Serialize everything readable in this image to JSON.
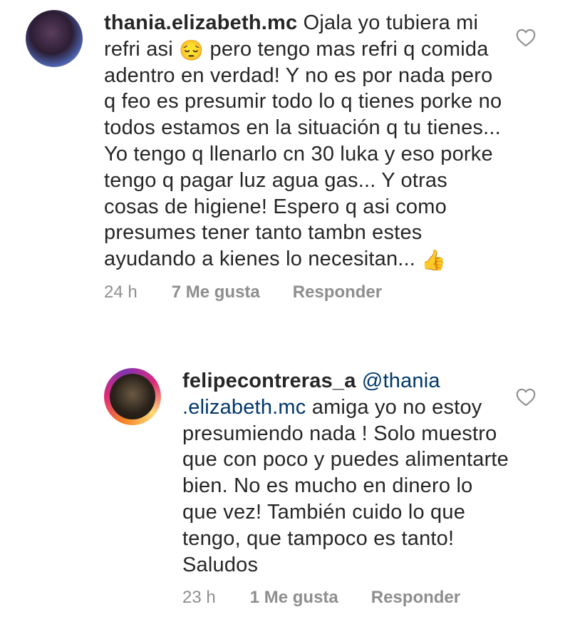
{
  "comments": [
    {
      "username": "thania.elizabeth.mc",
      "text_part1": "Ojala yo tubiera mi refri asi",
      "emoji1": "😔",
      "text_part2": "pero tengo mas refri q comida adentro en verdad! Y no es por nada pero q feo es presumir todo lo q tienes porke no todos estamos en la situación q tu tienes... Yo tengo q llenarlo cn 30 luka y eso porke tengo q pagar luz agua gas... Y otras cosas de higiene! Espero q asi como presumes tener tanto tambn estes ayudando a kienes lo necesitan...",
      "emoji2": "👍",
      "time": "24 h",
      "likes": "7 Me gusta",
      "reply": "Responder"
    },
    {
      "username": "felipecontreras_a",
      "mention": "@thania .elizabeth.mc",
      "text": "amiga yo no estoy presumiendo nada ! Solo muestro que con poco y puedes alimentarte bien. No es mucho en dinero lo que vez! También cuido lo que tengo, que tampoco es tanto! Saludos",
      "time": "23 h",
      "likes": "1 Me gusta",
      "reply": "Responder"
    }
  ],
  "icons": {
    "like": "heart-outline-icon",
    "avatar_1": "user-avatar",
    "avatar_2": "user-avatar-story-ring"
  },
  "colors": {
    "text": "#262626",
    "meta": "#8e8e8e",
    "mention": "#00376b"
  }
}
